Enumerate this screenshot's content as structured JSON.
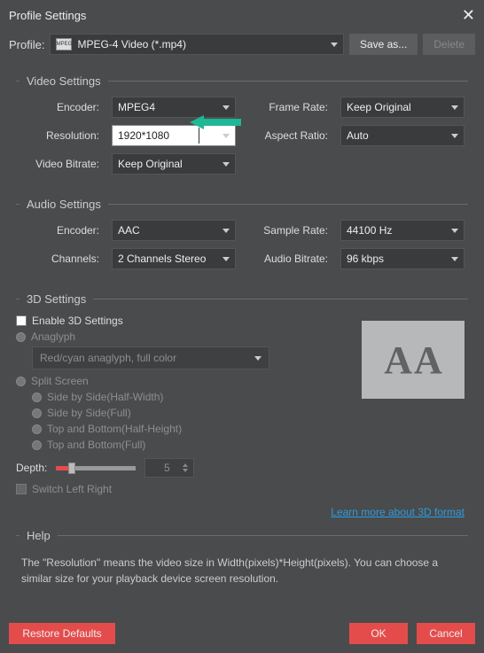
{
  "title": "Profile Settings",
  "profile": {
    "label": "Profile:",
    "value": "MPEG-4 Video (*.mp4)",
    "save_as": "Save as...",
    "delete": "Delete"
  },
  "video": {
    "section": "Video Settings",
    "encoder_lbl": "Encoder:",
    "encoder": "MPEG4",
    "framerate_lbl": "Frame Rate:",
    "framerate": "Keep Original",
    "resolution_lbl": "Resolution:",
    "resolution": "1920*1080",
    "aspect_lbl": "Aspect Ratio:",
    "aspect": "Auto",
    "bitrate_lbl": "Video Bitrate:",
    "bitrate": "Keep Original"
  },
  "audio": {
    "section": "Audio Settings",
    "encoder_lbl": "Encoder:",
    "encoder": "AAC",
    "sample_lbl": "Sample Rate:",
    "sample": "44100 Hz",
    "channels_lbl": "Channels:",
    "channels": "2 Channels Stereo",
    "bitrate_lbl": "Audio Bitrate:",
    "bitrate": "96 kbps"
  },
  "three_d": {
    "section": "3D Settings",
    "enable": "Enable 3D Settings",
    "anaglyph": "Anaglyph",
    "anaglyph_mode": "Red/cyan anaglyph, full color",
    "split": "Split Screen",
    "sbs_half": "Side by Side(Half-Width)",
    "sbs_full": "Side by Side(Full)",
    "tb_half": "Top and Bottom(Half-Height)",
    "tb_full": "Top and Bottom(Full)",
    "depth_lbl": "Depth:",
    "depth_val": "5",
    "switch_lr": "Switch Left Right",
    "learn_more": "Learn more about 3D format"
  },
  "help": {
    "section": "Help",
    "text": "The \"Resolution\" means the video size in Width(pixels)*Height(pixels).  You can choose a similar size for your playback device screen resolution."
  },
  "footer": {
    "restore": "Restore Defaults",
    "ok": "OK",
    "cancel": "Cancel"
  }
}
